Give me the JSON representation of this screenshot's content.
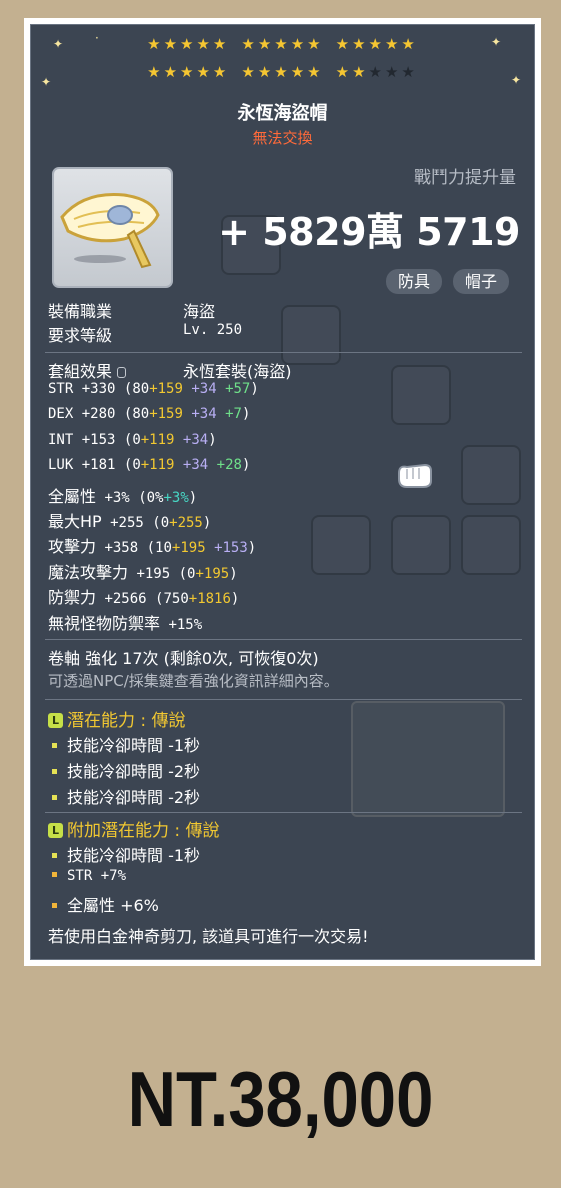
{
  "item": {
    "name": "永恆海盜帽",
    "trade_status": "無法交換",
    "star_force": {
      "total": 25,
      "filled": 22
    },
    "power_label": "戰鬥力提升量",
    "power_value": "+ 5829萬 5719",
    "tags": [
      "防具",
      "帽子"
    ],
    "job_label": "裝備職業",
    "job_value": "海盜",
    "level_label": "要求等級",
    "level_value": "Lv. 250"
  },
  "set": {
    "label": "套組效果",
    "value": "永恆套裝(海盜)"
  },
  "stats": [
    {
      "name": "STR",
      "total": "+330",
      "open": "(80",
      "bonus": "+159",
      "extra": "+34",
      "star": "+57",
      "close": ")"
    },
    {
      "name": "DEX",
      "total": "+280",
      "open": "(80",
      "bonus": "+159",
      "extra": "+34",
      "star": "+7",
      "close": ")"
    },
    {
      "name": "INT",
      "total": "+153",
      "open": "(0",
      "bonus": "+119",
      "extra": "+34",
      "close": ")"
    },
    {
      "name": "LUK",
      "total": "+181",
      "open": "(0",
      "bonus": "+119",
      "extra": "+34",
      "star": "+28",
      "close": ")"
    },
    {
      "name": "全屬性",
      "total": "+3%",
      "open": "(0%",
      "bonus2": "+3%",
      "close": ")"
    },
    {
      "name": "最大HP",
      "total": "+255",
      "open": "(0",
      "bonus": "+255",
      "close": ")"
    },
    {
      "name": "攻擊力",
      "total": "+358",
      "open": "(10",
      "bonus": "+195",
      "extra": "+153",
      "close": ")"
    },
    {
      "name": "魔法攻擊力",
      "total": "+195",
      "open": "(0",
      "bonus": "+195",
      "close": ")"
    },
    {
      "name": "防禦力",
      "total": "+2566",
      "open": "(750",
      "bonus": "+1816",
      "close": ")"
    },
    {
      "name": "無視怪物防禦率",
      "total": "+15%"
    }
  ],
  "scroll": {
    "text": "卷軸 強化 17次 (剩餘0次, 可恢復0次)",
    "hint": "可透過NPC/採集鍵查看強化資訊詳細內容。"
  },
  "potential": {
    "header": "潛在能力 : 傳說",
    "lines": [
      "技能冷卻時間 -1秒",
      "技能冷卻時間 -2秒",
      "技能冷卻時間 -2秒"
    ]
  },
  "additional": {
    "header": "附加潛在能力 : 傳說",
    "lines": [
      "技能冷卻時間 -1秒",
      "STR +7%",
      "全屬性 +6%"
    ]
  },
  "footer": "若使用白金神奇剪刀, 該道具可進行一次交易!",
  "price": "NT.38,000",
  "icons": {
    "badge": "L",
    "lock": "lock-icon"
  },
  "colors": {
    "star": "#f5c632",
    "untradeable": "#ff6a3a",
    "potential": "#f2c831"
  }
}
